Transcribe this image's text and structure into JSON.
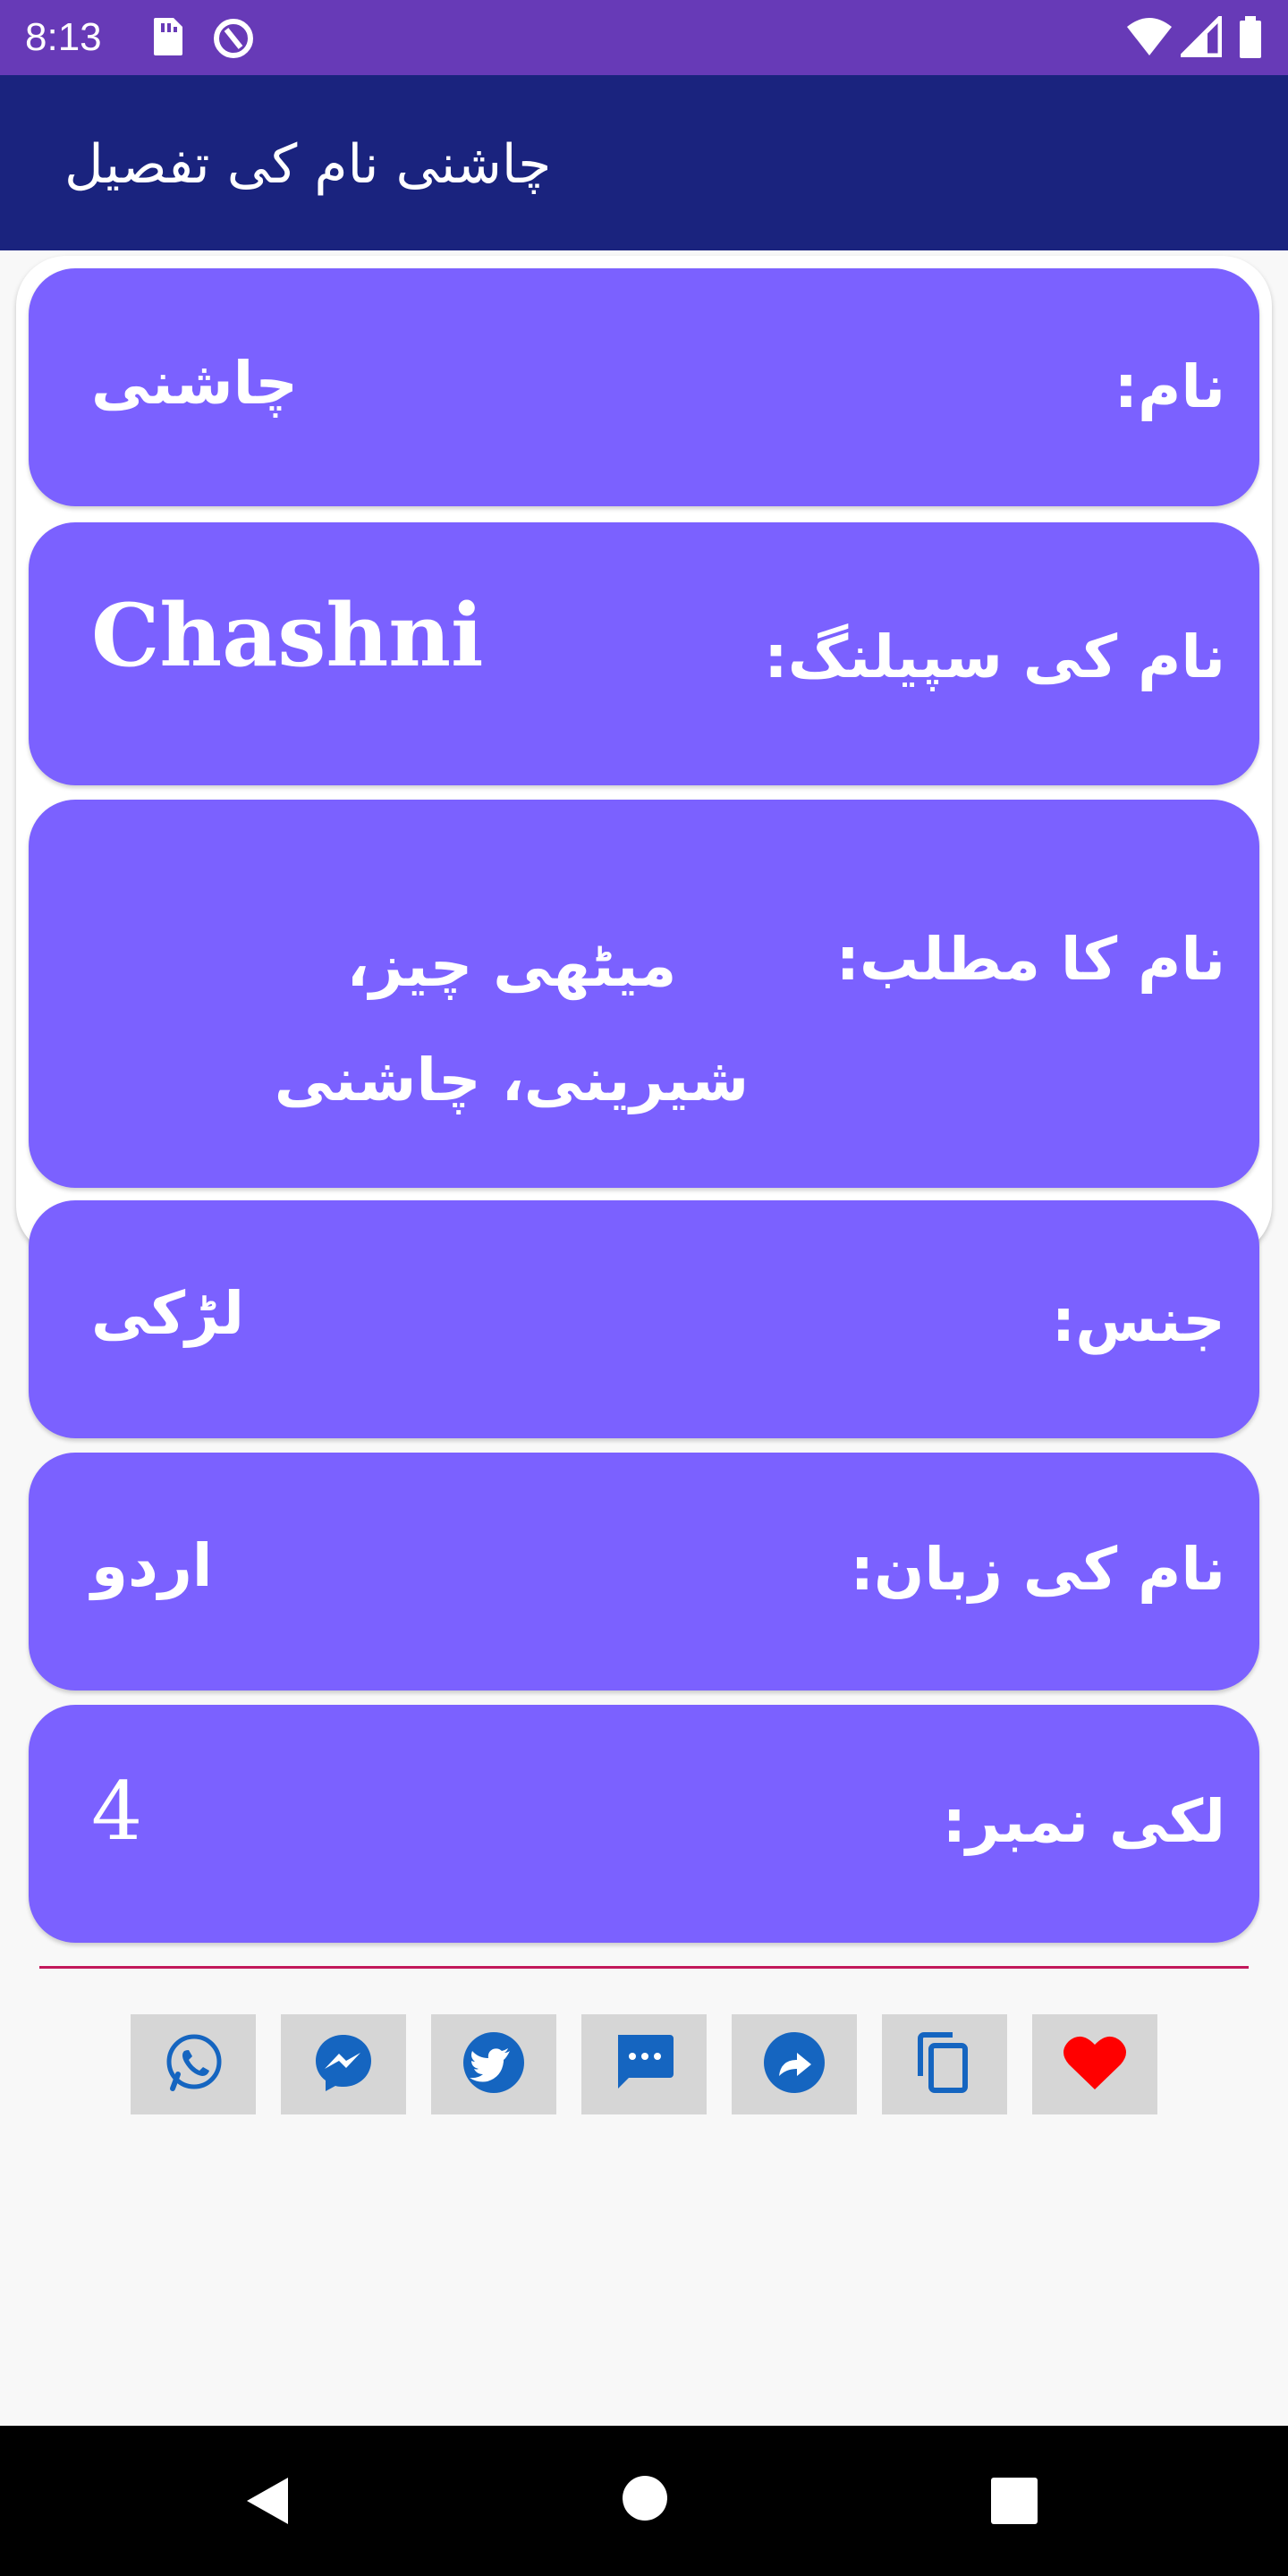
{
  "status_bar": {
    "time": "8:13",
    "icons": [
      "sd-card-icon",
      "data-saver-icon",
      "wifi-icon",
      "signal-icon",
      "battery-icon"
    ]
  },
  "app_bar": {
    "title": "چاشنی نام کی تفصیل"
  },
  "details": {
    "name_label": "نام:",
    "name_value": "چاشنی",
    "spelling_label": "نام کی سپیلنگ:",
    "spelling_value": "Chashni",
    "meaning_label": "نام کا مطلب:",
    "meaning_value": "میٹھی چیز، شیرینی، چاشنی",
    "gender_label": "جنس:",
    "gender_value": "لڑکی",
    "language_label": "نام کی زبان:",
    "language_value": "اردو",
    "lucky_label": "لکی نمبر:",
    "lucky_value": "4"
  },
  "share_bar": {
    "buttons": [
      "whatsapp-icon",
      "messenger-icon",
      "twitter-icon",
      "sms-icon",
      "share-icon",
      "copy-icon",
      "favorite-icon"
    ]
  },
  "colors": {
    "status_bar": "#673ab7",
    "app_bar": "#1a237e",
    "row_background": "#7b61ff",
    "divider": "#c2185b",
    "icon_blue": "#1565c0",
    "heart_red": "#ff0000"
  },
  "nav_bar": {
    "buttons": [
      "back-icon",
      "home-icon",
      "recents-icon"
    ]
  }
}
